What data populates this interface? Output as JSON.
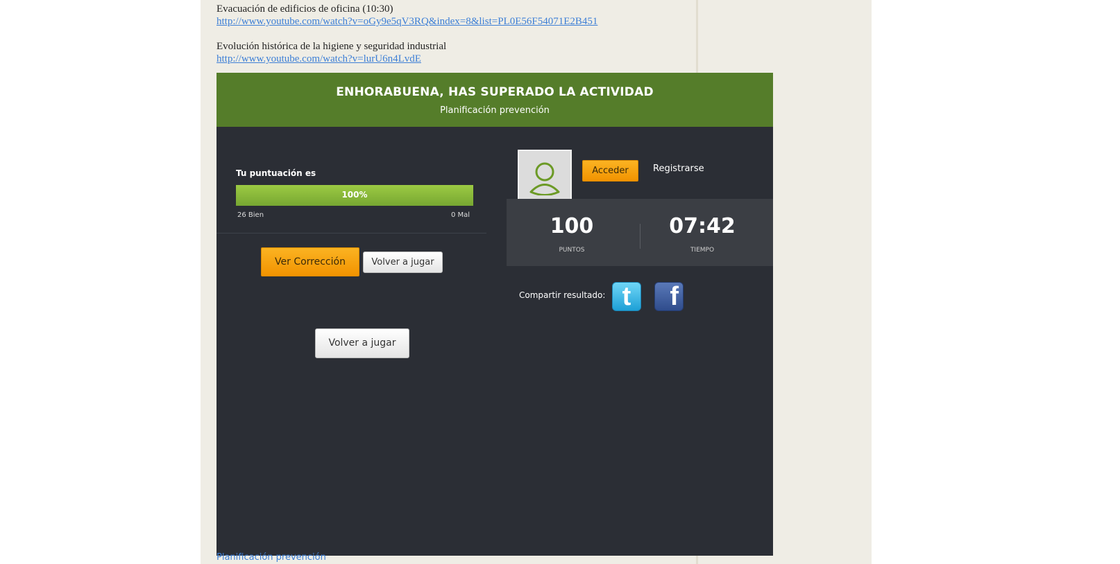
{
  "blog": {
    "item1_title": "Evacuación de edificios de oficina (10:30)",
    "item1_link": "http://www.youtube.com/watch?v=oGy9e5qV3RQ&index=8&list=PL0E56F54071E2B451",
    "item2_title": "Evolución histórica de la higiene y seguridad industrial",
    "item2_link": "http://www.youtube.com/watch?v=lurU6n4LvdE",
    "footer_link": "Planificación prevención"
  },
  "game": {
    "title": "ENHORABUENA, HAS SUPERADO LA ACTIVIDAD",
    "subtitle": "Planificación prevención",
    "score_label": "Tu puntuación es",
    "score_percent": "100%",
    "score_fraction": 1.0,
    "correct": "26 Bien",
    "wrong": "0 Mal",
    "ver_correccion": "Ver Corrección",
    "volver_small": "Volver a jugar",
    "volver_large": "Volver a jugar",
    "acceder": "Acceder",
    "registrarse": "Registrarse",
    "points_value": "100",
    "points_label": "PUNTOS",
    "time_value": "07:42",
    "time_label": "TIEMPO",
    "share_label": "Compartir resultado:",
    "twitter_glyph": "t",
    "facebook_glyph": "f",
    "icons": {
      "avatar": "user-avatar-icon",
      "twitter": "twitter-icon",
      "facebook": "facebook-icon"
    },
    "colors": {
      "header": "#557d2a",
      "panel": "#2b2e35",
      "progress": "#8cbd3d",
      "accent": "#f7a716"
    }
  }
}
